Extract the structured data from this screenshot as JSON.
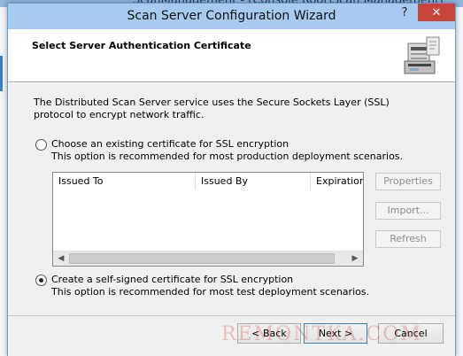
{
  "background": {
    "title_fragment": "ScanManagement - [Console Root\\Scan Management\\"
  },
  "window": {
    "title": "Scan Server Configuration Wizard",
    "help_glyph": "?",
    "close_glyph": "✕"
  },
  "header": {
    "title": "Select Server Authentication Certificate",
    "icon": "server-printer-icon"
  },
  "intro_text": "The Distributed Scan Server service uses the Secure Sockets Layer (SSL) protocol to encrypt network traffic.",
  "options": [
    {
      "label": "Choose an existing certificate for SSL encryption",
      "description": "This option is recommended for most production deployment scenarios.",
      "selected": false
    },
    {
      "label": "Create a self-signed certificate for SSL encryption",
      "description": "This option is recommended for most test deployment scenarios.",
      "selected": true
    }
  ],
  "certificate_list": {
    "columns": [
      "Issued To",
      "Issued By",
      "Expiration D"
    ],
    "rows": []
  },
  "side_buttons": {
    "properties": "Properties",
    "import": "Import...",
    "refresh": "Refresh"
  },
  "footer_buttons": {
    "back": "< Back",
    "next": "Next >",
    "cancel": "Cancel"
  },
  "watermark": "REMONTKA.COM",
  "colors": {
    "titlebar": "#a6cbee",
    "close_button": "#c7453b",
    "dialog_body": "#f0f0f0",
    "disabled_text": "#8d8d8d"
  }
}
